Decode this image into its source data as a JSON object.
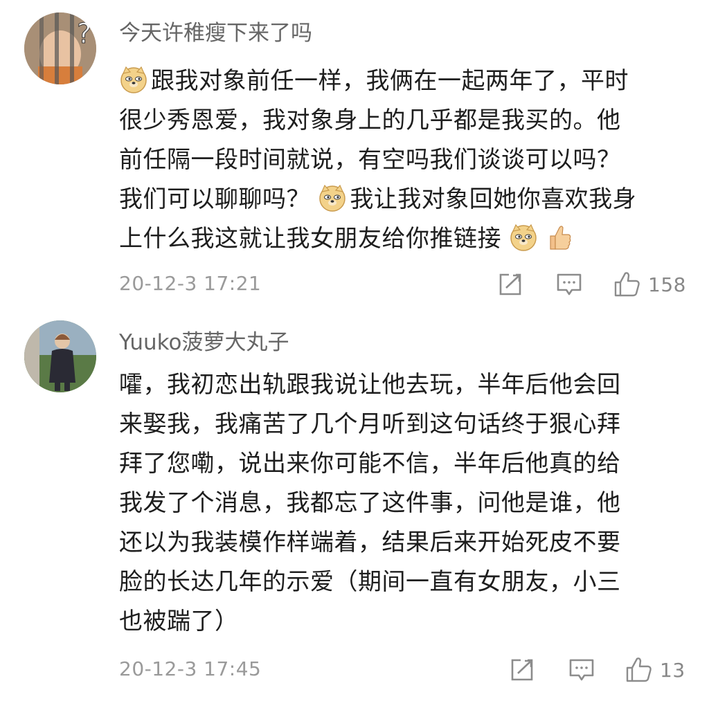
{
  "comments": [
    {
      "username": "今天许稚瘦下来了吗",
      "lines": [
        "跟我对象前任一样，我俩在一起两年了，平时",
        "很少秀恩爱，我对象身上的几乎都是我买的。他",
        "前任隔一段时间就说，有空吗我们谈谈可以吗？",
        "我们可以聊聊吗？",
        "我让我对象回她你喜欢我身",
        "上什么我这就让我女朋友给你推链接"
      ],
      "timestamp": "20-12-3 17:21",
      "like_count": "158",
      "icons": {
        "avatar": "avatar-child-question-mark",
        "emoji": "doge-emoji",
        "thumb": "thumbs-up-emoji"
      }
    },
    {
      "username": "Yuuko菠萝大丸子",
      "lines": [
        "嚯，我初恋出轨跟我说让他去玩，半年后他会回",
        "来娶我，我痛苦了几个月听到这句话终于狠心拜",
        "拜了您嘞，说出来你可能不信，半年后他真的给",
        "我发了个消息，我都忘了这件事，问他是谁，他",
        "还以为我装模作样端着，结果后来开始死皮不要",
        "脸的长达几年的示爱（期间一直有女朋友，小三",
        "也被踹了）"
      ],
      "timestamp": "20-12-3 17:45",
      "like_count": "13",
      "icons": {
        "avatar": "avatar-child-outdoor-photo"
      }
    }
  ],
  "actions": {
    "share_icon": "share-icon",
    "reply_icon": "comment-icon",
    "like_icon": "thumbs-up-icon"
  },
  "colors": {
    "username": "#666666",
    "body_text": "#1e1e1e",
    "meta": "#9a9a9a",
    "icon": "#8c8c8c",
    "doge": "#f3d28a"
  }
}
